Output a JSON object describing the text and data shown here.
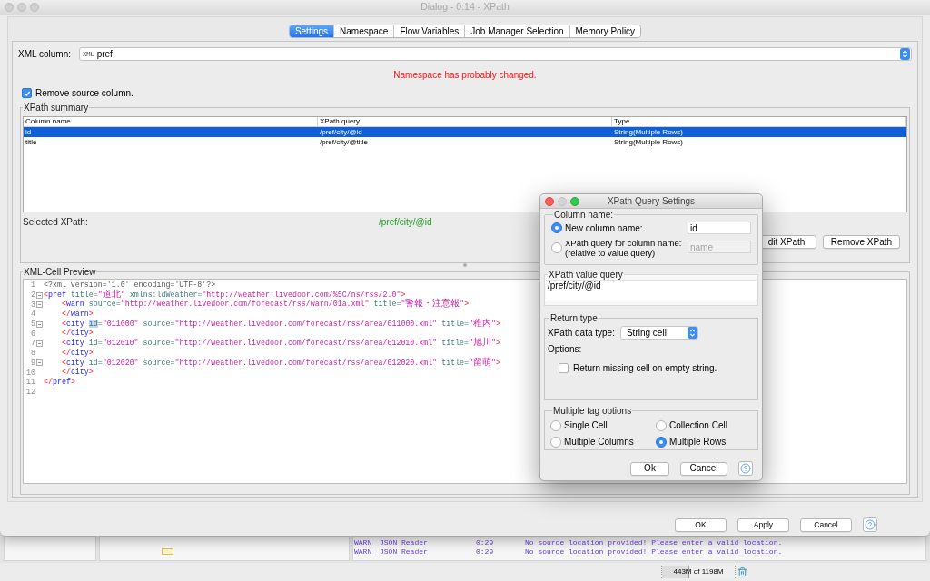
{
  "window": {
    "title": "Dialog - 0:14 - XPath"
  },
  "tabs": [
    {
      "label": "Settings",
      "selected": true
    },
    {
      "label": "Namespace",
      "selected": false
    },
    {
      "label": "Flow Variables",
      "selected": false
    },
    {
      "label": "Job Manager Selection",
      "selected": false
    },
    {
      "label": "Memory Policy",
      "selected": false
    }
  ],
  "xml_column": {
    "label": "XML column:",
    "type_label": "XML",
    "value": "pref"
  },
  "warning": "Namespace has probably changed.",
  "remove_source_column": {
    "label": "Remove source column.",
    "checked": true
  },
  "xpath_summary": {
    "title": "XPath summary",
    "columns": [
      "Column name",
      "XPath query",
      "Type"
    ],
    "rows": [
      {
        "cells": [
          "id",
          "/pref/city/@id",
          "String(Multiple Rows)"
        ],
        "selected": true
      },
      {
        "cells": [
          "title",
          "/pref/city/@title",
          "String(Multiple Rows)"
        ],
        "selected": false
      }
    ],
    "selected_label": "Selected XPath:",
    "selected_value": "/pref/city/@id",
    "buttons": [
      "dit XPath",
      "Remove XPath"
    ]
  },
  "preview": {
    "title": "XML-Cell Preview",
    "lines": [
      {
        "number": "1",
        "foldable": false,
        "tokens": [
          {
            "kind": "decl",
            "text": "<?xml version='1.0' encoding='UTF-8'?>"
          }
        ]
      },
      {
        "number": "2",
        "foldable": true,
        "tokens": [
          {
            "kind": "bracket",
            "text": "<"
          },
          {
            "kind": "tag",
            "text": "pref"
          },
          {
            "kind": "attr",
            "text": " title="
          },
          {
            "kind": "value",
            "text": "\"道北\""
          },
          {
            "kind": "attr",
            "text": " xmlns:ldWeather="
          },
          {
            "kind": "value",
            "text": "\"http://weather.livedoor.com/%5C/ns/rss/2.0\""
          },
          {
            "kind": "bracket",
            "text": ">"
          }
        ]
      },
      {
        "number": "3",
        "foldable": true,
        "tokens": [
          {
            "kind": "bracket",
            "text": "    <"
          },
          {
            "kind": "tag",
            "text": "warn"
          },
          {
            "kind": "attr",
            "text": " source="
          },
          {
            "kind": "value",
            "text": "\"http://weather.livedoor.com/forecast/rss/warn/01a.xml\""
          },
          {
            "kind": "attr",
            "text": " title="
          },
          {
            "kind": "value",
            "text": "\"警報・注意報\""
          },
          {
            "kind": "bracket",
            "text": ">"
          }
        ]
      },
      {
        "number": "4",
        "foldable": false,
        "tokens": [
          {
            "kind": "bracket",
            "text": "    </"
          },
          {
            "kind": "tag",
            "text": "warn"
          },
          {
            "kind": "bracket",
            "text": ">"
          }
        ]
      },
      {
        "number": "5",
        "foldable": true,
        "tokens": [
          {
            "kind": "bracket",
            "text": "    <"
          },
          {
            "kind": "tag",
            "text": "city "
          },
          {
            "kind": "match",
            "text": "id"
          },
          {
            "kind": "attr",
            "text": "="
          },
          {
            "kind": "value",
            "text": "\"011000\""
          },
          {
            "kind": "attr",
            "text": " source="
          },
          {
            "kind": "value",
            "text": "\"http://weather.livedoor.com/forecast/rss/area/011000.xml\""
          },
          {
            "kind": "attr",
            "text": " title="
          },
          {
            "kind": "value",
            "text": "\"稚内\""
          },
          {
            "kind": "bracket",
            "text": ">"
          }
        ]
      },
      {
        "number": "6",
        "foldable": false,
        "tokens": [
          {
            "kind": "bracket",
            "text": "    </"
          },
          {
            "kind": "tag",
            "text": "city"
          },
          {
            "kind": "bracket",
            "text": ">"
          }
        ]
      },
      {
        "number": "7",
        "foldable": true,
        "tokens": [
          {
            "kind": "bracket",
            "text": "    <"
          },
          {
            "kind": "tag",
            "text": "city"
          },
          {
            "kind": "attr",
            "text": " id="
          },
          {
            "kind": "value",
            "text": "\"012010\""
          },
          {
            "kind": "attr",
            "text": " source="
          },
          {
            "kind": "value",
            "text": "\"http://weather.livedoor.com/forecast/rss/area/012010.xml\""
          },
          {
            "kind": "attr",
            "text": " title="
          },
          {
            "kind": "value",
            "text": "\"旭川\""
          },
          {
            "kind": "bracket",
            "text": ">"
          }
        ]
      },
      {
        "number": "8",
        "foldable": false,
        "tokens": [
          {
            "kind": "bracket",
            "text": "    </"
          },
          {
            "kind": "tag",
            "text": "city"
          },
          {
            "kind": "bracket",
            "text": ">"
          }
        ]
      },
      {
        "number": "9",
        "foldable": true,
        "tokens": [
          {
            "kind": "bracket",
            "text": "    <"
          },
          {
            "kind": "tag",
            "text": "city"
          },
          {
            "kind": "attr",
            "text": " id="
          },
          {
            "kind": "value",
            "text": "\"012020\""
          },
          {
            "kind": "attr",
            "text": " source="
          },
          {
            "kind": "value",
            "text": "\"http://weather.livedoor.com/forecast/rss/area/012020.xml\""
          },
          {
            "kind": "attr",
            "text": " title="
          },
          {
            "kind": "value",
            "text": "\"留萌\""
          },
          {
            "kind": "bracket",
            "text": ">"
          }
        ]
      },
      {
        "number": "10",
        "foldable": false,
        "tokens": [
          {
            "kind": "bracket",
            "text": "    </"
          },
          {
            "kind": "tag",
            "text": "city"
          },
          {
            "kind": "bracket",
            "text": ">"
          }
        ]
      },
      {
        "number": "11",
        "foldable": false,
        "tokens": [
          {
            "kind": "bracket",
            "text": "</"
          },
          {
            "kind": "tag",
            "text": "pref"
          },
          {
            "kind": "bracket",
            "text": ">"
          }
        ]
      },
      {
        "number": "12",
        "foldable": false
      }
    ]
  },
  "buttons": [
    "OK",
    "Apply",
    "Cancel"
  ],
  "query_dialog": {
    "title": "XPath Query Settings",
    "column_name": {
      "title": "Column name:",
      "options": [
        {
          "label": "New column name:",
          "selected": true,
          "value": "id",
          "disabled": false
        },
        {
          "label": "XPath query for column name:",
          "note": "(relative to value query)",
          "selected": false,
          "placeholder": "name",
          "disabled": true
        }
      ]
    },
    "value_query": {
      "title": "XPath value query",
      "value": "/pref/city/@id"
    },
    "return_type": {
      "title": "Return type",
      "data_type_label": "XPath data type:",
      "data_type": "String cell",
      "options_label": "Options:",
      "missing_cell": {
        "label": "Return missing cell on empty string.",
        "checked": false
      }
    },
    "multiple_tag": {
      "title": "Multiple tag options",
      "options": [
        {
          "label": "Single Cell",
          "selected": false
        },
        {
          "label": "Collection Cell",
          "selected": false
        },
        {
          "label": "Multiple Columns",
          "selected": false
        },
        {
          "label": "Multiple Rows",
          "selected": true
        }
      ]
    },
    "buttons": [
      "Ok",
      "Cancel"
    ]
  },
  "background": {
    "log": [
      {
        "level": "WARN",
        "source": "JSON Reader",
        "time": "0:29",
        "message": "No source location provided! Please enter a valid location."
      },
      {
        "level": "WARN",
        "source": "JSON Reader",
        "time": "0:29",
        "message": "No source location provided! Please enter a valid location."
      }
    ],
    "memory": {
      "text": "443M of 1198M",
      "level": 0.37
    }
  }
}
